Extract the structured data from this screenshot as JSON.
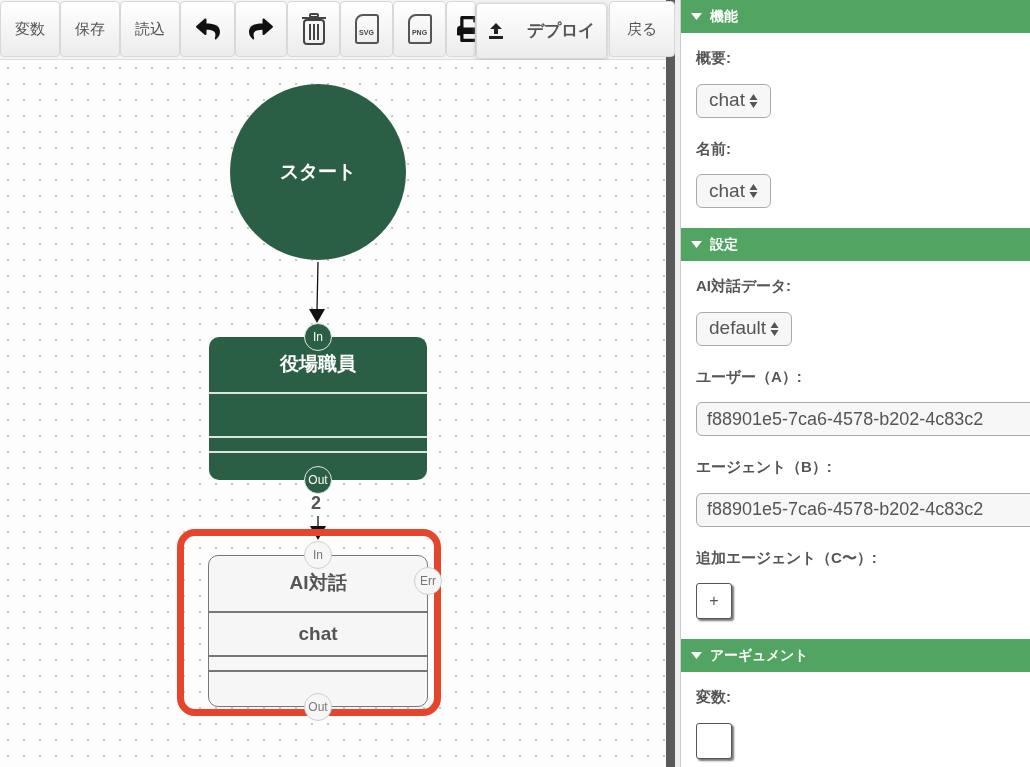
{
  "toolbar": {
    "buttons": [
      {
        "kind": "text",
        "label": "変数"
      },
      {
        "kind": "text",
        "label": "保存"
      },
      {
        "kind": "text",
        "label": "読込"
      },
      {
        "kind": "undo"
      },
      {
        "kind": "redo"
      },
      {
        "kind": "trash"
      },
      {
        "kind": "file",
        "label": "SVG"
      },
      {
        "kind": "file",
        "label": "PNG"
      },
      {
        "kind": "print"
      }
    ],
    "deploy": "デプロイ",
    "back": "戻る"
  },
  "canvas": {
    "start": "スタート",
    "edge_label": "2",
    "nodes": [
      {
        "kind": "actor",
        "title": "役場職員",
        "selected": false,
        "ports": [
          {
            "kind": "in",
            "label": "In"
          },
          {
            "kind": "out",
            "label": "Out"
          }
        ]
      },
      {
        "kind": "function",
        "title": "AI対話",
        "subtitle": "chat",
        "selected": true,
        "ports": [
          {
            "kind": "in",
            "label": "In"
          },
          {
            "kind": "err",
            "label": "Err"
          },
          {
            "kind": "out",
            "label": "Out"
          }
        ]
      }
    ]
  },
  "panel": {
    "sections": [
      {
        "title": "機能",
        "expanded": true,
        "fields": [
          {
            "kind": "select",
            "label": "概要:",
            "value": "chat"
          },
          {
            "kind": "select",
            "label": "名前:",
            "value": "chat"
          }
        ]
      },
      {
        "title": "設定",
        "expanded": true,
        "fields": [
          {
            "kind": "select",
            "label": "AI対話データ:",
            "value": "default"
          },
          {
            "kind": "text",
            "label": "ユーザー（A）:",
            "value": "f88901e5-7ca6-4578-b202-4c83c2"
          },
          {
            "kind": "text",
            "label": "エージェント（B）:",
            "value": "f88901e5-7ca6-4578-b202-4c83c2"
          },
          {
            "kind": "add",
            "label": "追加エージェント（C〜）:",
            "button": "+"
          }
        ]
      },
      {
        "title": "アーギュメント",
        "expanded": true,
        "fields": [
          {
            "kind": "add",
            "label": "変数:"
          }
        ]
      }
    ]
  }
}
